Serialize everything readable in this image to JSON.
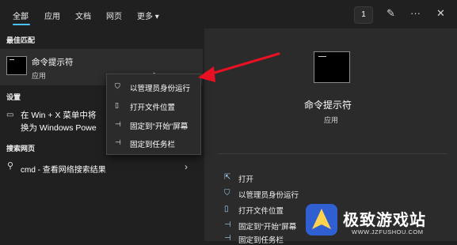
{
  "tabs": [
    "全部",
    "应用",
    "文档",
    "网页",
    "更多 ▾"
  ],
  "topbar": {
    "badge": "1"
  },
  "left": {
    "best_match": "最佳匹配",
    "app_title": "命令提示符",
    "app_sub": "应用",
    "settings": "设置",
    "setting_line1": "在 Win + X 菜单中将",
    "setting_line2": "换为 Windows Powe",
    "web_section": "搜索网页",
    "web_query": "cmd - 查看网络搜索结果"
  },
  "context_menu": [
    "以管理员身份运行",
    "打开文件位置",
    "固定到\"开始\"屏幕",
    "固定到任务栏"
  ],
  "right": {
    "app_title": "命令提示符",
    "app_sub": "应用",
    "actions": [
      "打开",
      "以管理员身份运行",
      "打开文件位置",
      "固定到\"开始\"屏幕",
      "固定到任务栏"
    ]
  },
  "watermark": {
    "brand": "极致游戏站",
    "url": "WWW.JZFUSHOU.COM"
  },
  "colors": {
    "accent": "#4cc2ff",
    "arrow": "#e81123"
  }
}
